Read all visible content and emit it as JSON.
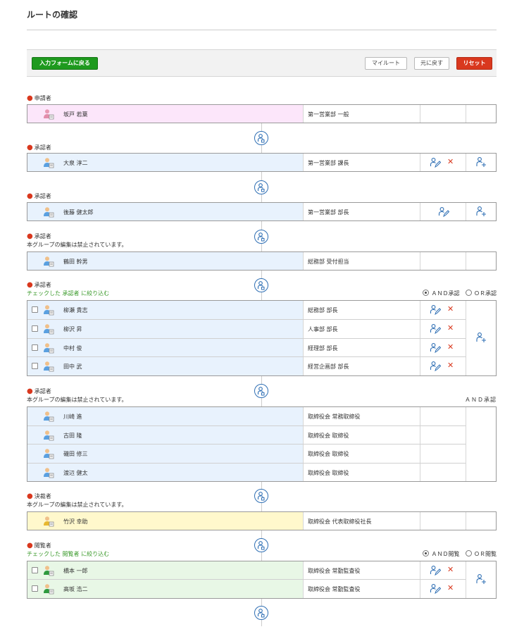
{
  "page": {
    "title": "ルートの確認"
  },
  "toolbar": {
    "back_label": "入力フォームに戻る",
    "myroute_label": "マイルート",
    "undo_label": "元に戻す",
    "reset_label": "リセット"
  },
  "colors": {
    "applicant_bg": "#fce6fa",
    "approver_bg": "#e8f2fd",
    "decider_bg": "#fff8cc",
    "viewer_bg": "#e8f7e6",
    "accent_green": "#1e9a1e",
    "accent_red": "#d9381e",
    "icon_blue": "#2f6fb4"
  },
  "icons": {
    "add_step": "add-approver-icon",
    "edit": "edit-user-icon",
    "delete": "delete-x-icon",
    "add_user": "add-user-icon",
    "avatar": "user-avatar-icon"
  },
  "sections": [
    {
      "label": "申請者",
      "rows": [
        {
          "name": "坂戸 若葉",
          "post": "第一営業部 一般"
        }
      ]
    },
    {
      "label": "承認者",
      "rows": [
        {
          "name": "大泉 淳二",
          "post": "第一営業部 課長"
        }
      ]
    },
    {
      "label": "承認者",
      "rows": [
        {
          "name": "後藤 健太郎",
          "post": "第一営業部 部長"
        }
      ]
    },
    {
      "label": "承認者",
      "note": "本グループの編集は禁止されています。",
      "rows": [
        {
          "name": "鶴田 幹男",
          "post": "総務部 受付担当"
        }
      ]
    },
    {
      "label": "承認者",
      "filter": "チェックした 承認者 に絞り込む",
      "mode_and": "ＡＮＤ承認",
      "mode_or": "ＯＲ承認",
      "rows": [
        {
          "name": "柳瀬 貴志",
          "post": "総務部 部長"
        },
        {
          "name": "柳沢 昇",
          "post": "人事部 部長"
        },
        {
          "name": "中村 俊",
          "post": "経理部 部長"
        },
        {
          "name": "田中 武",
          "post": "経営企画部 部長"
        }
      ]
    },
    {
      "label": "承認者",
      "note": "本グループの編集は禁止されています。",
      "mode": "ＡＮＤ承認",
      "rows": [
        {
          "name": "川崎 進",
          "post": "取締役会 常務取締役"
        },
        {
          "name": "古田 隆",
          "post": "取締役会 取締役"
        },
        {
          "name": "磯田 修三",
          "post": "取締役会 取締役"
        },
        {
          "name": "渡辺 健太",
          "post": "取締役会 取締役"
        }
      ]
    },
    {
      "label": "決裁者",
      "note": "本グループの編集は禁止されています。",
      "rows": [
        {
          "name": "竹沢 幸助",
          "post": "取締役会 代表取締役社長"
        }
      ]
    },
    {
      "label": "閲覧者",
      "filter": "チェックした 閲覧者 に絞り込む",
      "mode_and": "ＡＮＤ閲覧",
      "mode_or": "ＯＲ閲覧",
      "rows": [
        {
          "name": "橋本 一郎",
          "post": "取締役会 常勤監査役"
        },
        {
          "name": "高坂 浩二",
          "post": "取締役会 常勤監査役"
        }
      ]
    }
  ]
}
